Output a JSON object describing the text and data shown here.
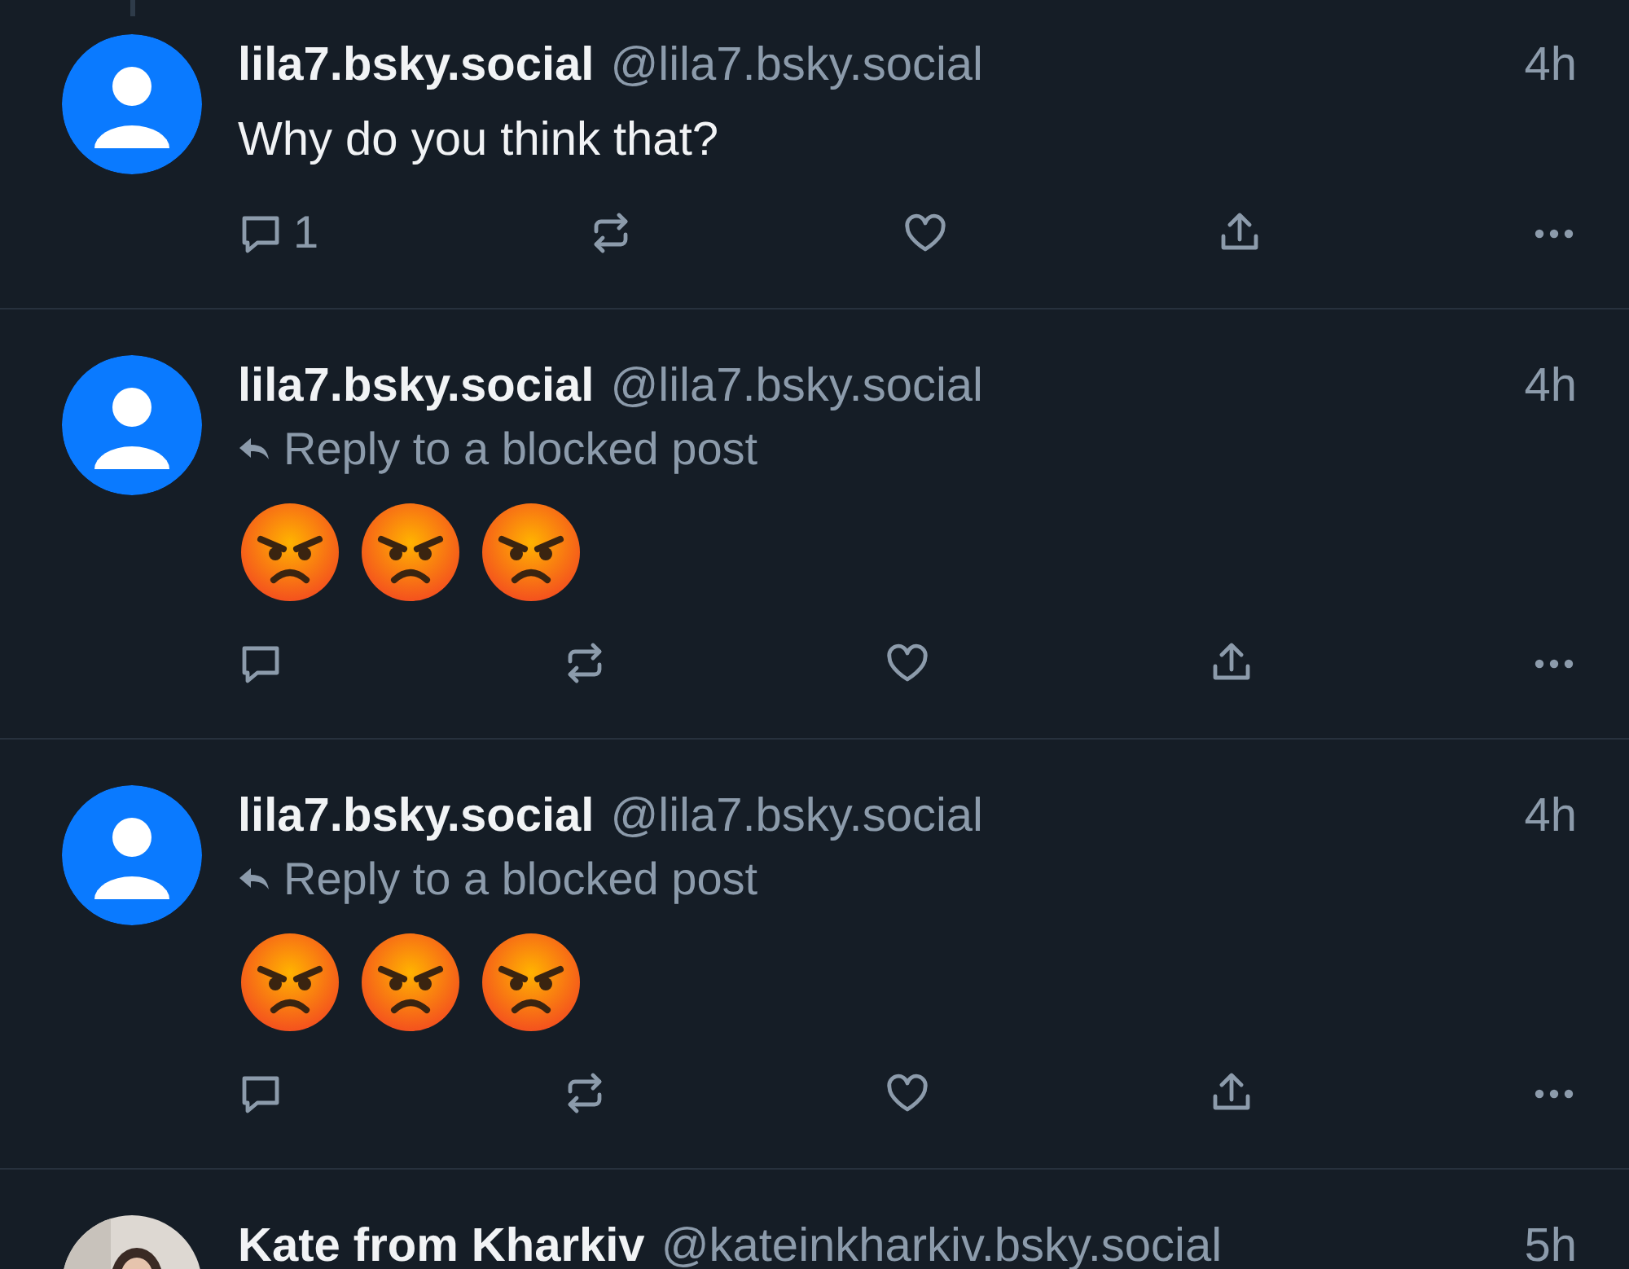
{
  "posts": [
    {
      "avatar": {
        "kind": "default"
      },
      "name": "lila7.bsky.social",
      "handle": "@lila7.bsky.social",
      "time": "4h",
      "text": "Why do you think that?",
      "actions": [
        {
          "kind": "reply",
          "count": "1"
        },
        {
          "kind": "repost"
        },
        {
          "kind": "like"
        },
        {
          "kind": "share"
        },
        {
          "kind": "more"
        }
      ]
    },
    {
      "avatar": {
        "kind": "default"
      },
      "name": "lila7.bsky.social",
      "handle": "@lila7.bsky.social",
      "time": "4h",
      "reply_note": "Reply to a blocked post",
      "emojis": [
        {
          "kind": "angry"
        },
        {
          "kind": "angry"
        },
        {
          "kind": "angry"
        }
      ],
      "actions": [
        {
          "kind": "reply"
        },
        {
          "kind": "repost"
        },
        {
          "kind": "like"
        },
        {
          "kind": "share"
        },
        {
          "kind": "more"
        }
      ]
    },
    {
      "avatar": {
        "kind": "default"
      },
      "name": "lila7.bsky.social",
      "handle": "@lila7.bsky.social",
      "time": "4h",
      "reply_note": "Reply to a blocked post",
      "emojis": [
        {
          "kind": "angry"
        },
        {
          "kind": "angry"
        },
        {
          "kind": "angry"
        }
      ],
      "actions": [
        {
          "kind": "reply"
        },
        {
          "kind": "repost"
        },
        {
          "kind": "like"
        },
        {
          "kind": "share"
        },
        {
          "kind": "more"
        }
      ]
    },
    {
      "name": "Kate from Kharkiv",
      "handle": "@kateinkharkiv.bsky.social",
      "time": "5h"
    }
  ]
}
